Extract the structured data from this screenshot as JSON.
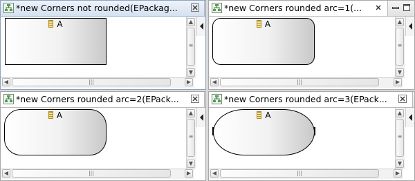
{
  "editors": [
    {
      "title": "*new Corners not rounded(EPackag...",
      "active": true,
      "node_label": "A",
      "arc": "none"
    },
    {
      "title": "*new Corners rounded arc=1(...",
      "active": false,
      "node_label": "A",
      "arc": "1"
    },
    {
      "title": "*new Corners rounded arc=2(EPack...",
      "active": false,
      "node_label": "A",
      "arc": "2"
    },
    {
      "title": "*new Corners rounded arc=3(EPack...",
      "active": false,
      "node_label": "A",
      "arc": "3"
    }
  ],
  "icons": {
    "tab": "diagram-editor-icon",
    "close": "close-icon",
    "minimize": "minimize-icon",
    "maximize": "maximize-icon",
    "palette": "palette-toggle-icon",
    "node": "eclass-icon"
  },
  "scroll_grip": "|||",
  "colors": {
    "active_tab": "#c6d5ea",
    "node_border": "#000000",
    "node_gradient_end": "#c9c9c9"
  }
}
